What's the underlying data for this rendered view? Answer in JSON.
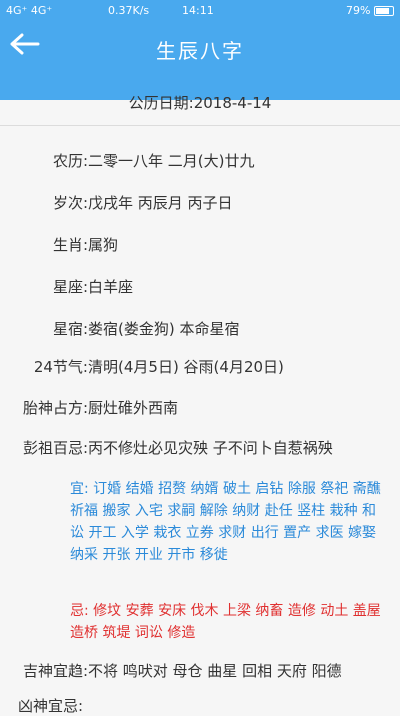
{
  "status": {
    "signal": "4G⁺ 4G⁺",
    "speed": "0.37K/s",
    "time": "14:11",
    "battery": "79%"
  },
  "header": {
    "back_icon": "arrow-left-icon",
    "title": "生辰八字"
  },
  "date": "公历日期:2018-4-14",
  "rows": [
    {
      "label": "农历:",
      "value": "二零一八年 二月(大)廿九"
    },
    {
      "label": "岁次:",
      "value": "戊戌年 丙辰月 丙子日"
    },
    {
      "label": "生肖:",
      "value": "属狗"
    },
    {
      "label": "星座:",
      "value": "白羊座"
    },
    {
      "label": "星宿:",
      "value": "娄宿(娄金狗) 本命星宿"
    },
    {
      "label": "24节气:",
      "value": "清明(4月5日) 谷雨(4月20日)"
    },
    {
      "label": "胎神占方:",
      "value": "厨灶碓外西南"
    },
    {
      "label": "彭祖百忌:",
      "value": "丙不修灶必见灾殃 子不问卜自惹祸殃"
    }
  ],
  "yi": {
    "label": "宜:",
    "text": "订婚 结婚 招赘 纳婿 破土 启钻 除服 祭祀 斋醮 祈福 搬家 入宅 求嗣 解除 纳财 赴任 竖柱 栽种 和讼 开工 入学 栽衣 立券 求财 出行 置产 求医 嫁娶 纳采 开张 开业 开市 移徙"
  },
  "ji": {
    "label": "忌:",
    "text": "修坟 安葬 安床 伐木 上梁 纳畜 造修 动土 盖屋 造桥 筑堤 词讼 修造"
  },
  "jishen": {
    "label": "吉神宜趋:",
    "value": "不将 鸣吠对 母仓 曲星 回相 天府 阳德"
  },
  "cut_label": "凶神宜忌:"
}
